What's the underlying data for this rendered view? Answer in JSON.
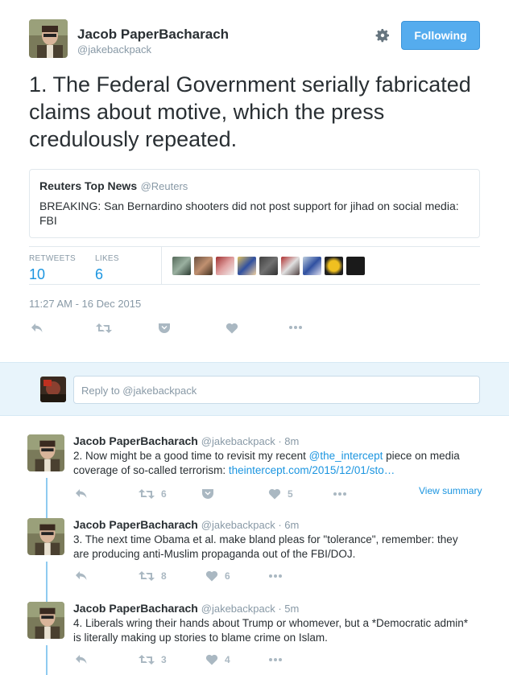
{
  "main_tweet": {
    "author_name": "Jacob PaperBacharach",
    "author_handle": "@jakebackpack",
    "follow_label": "Following",
    "text": "1. The Federal Government serially fabricated claims about motive, which the press credulously repeated.",
    "quote": {
      "name": "Reuters Top News",
      "handle": "@Reuters",
      "text": "BREAKING: San Bernardino shooters did not post support for jihad on social media: FBI"
    },
    "stats": {
      "retweets_label": "RETWEETS",
      "retweets_value": "10",
      "likes_label": "LIKES",
      "likes_value": "6"
    },
    "likers_count": 9,
    "timestamp": "11:27 AM - 16 Dec 2015"
  },
  "reply_box": {
    "placeholder": "Reply to @jakebackpack"
  },
  "replies": [
    {
      "name": "Jacob PaperBacharach",
      "meta": "@jakebackpack · 8m",
      "text_pre": "2. Now might be a good time to revisit my recent ",
      "mention": "@the_intercept",
      "text_mid": " piece on media coverage of so-called terrorism: ",
      "link": "theintercept.com/2015/12/01/sto…",
      "retweets": "6",
      "likes": "5",
      "view_summary": "View summary"
    },
    {
      "name": "Jacob PaperBacharach",
      "meta": "@jakebackpack · 6m",
      "text": "3. The next time Obama et al. make bland pleas for \"tolerance\", remember: they are producing anti-Muslim propaganda out of the FBI/DOJ.",
      "retweets": "8",
      "likes": "6"
    },
    {
      "name": "Jacob PaperBacharach",
      "meta": "@jakebackpack · 5m",
      "text": "4. Liberals wring their hands about Trump or whomever, but a *Democratic admin* is literally making up stories to blame crime on Islam.",
      "retweets": "3",
      "likes": "4"
    }
  ],
  "colors": {
    "accent": "#1b95e0",
    "follow_bg": "#55acee",
    "reply_bg": "#e8f4fb",
    "thread_line": "#8fcbf0"
  }
}
